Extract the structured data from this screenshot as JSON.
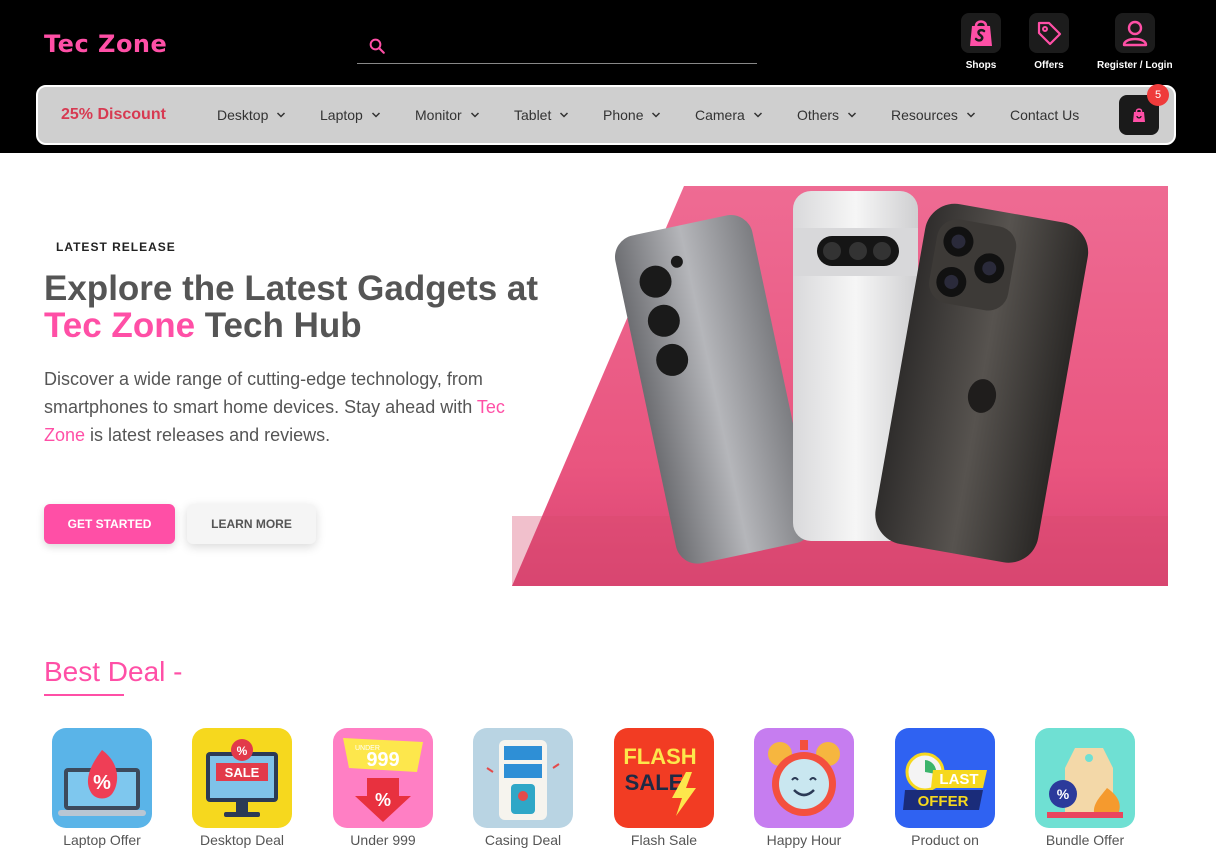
{
  "header": {
    "logo": "Tec Zone",
    "search_placeholder": "",
    "icons": [
      {
        "label": "Shops",
        "icon": "shopify-bag-icon"
      },
      {
        "label": "Offers",
        "icon": "tag-icon"
      },
      {
        "label": "Register / Login",
        "icon": "user-icon"
      }
    ]
  },
  "nav": {
    "discount": "25% Discount",
    "items": [
      "Desktop",
      "Laptop",
      "Monitor",
      "Tablet",
      "Phone",
      "Camera",
      "Others",
      "Resources",
      "Contact Us"
    ],
    "cart_count": "5"
  },
  "hero": {
    "eyebrow": "LATEST RELEASE",
    "title_line1": "Explore the Latest Gadgets at",
    "title_brand": "Tec Zone",
    "title_rest": " Tech Hub",
    "desc_part1": "Discover a wide range of cutting-edge technology, from smartphones to smart home devices. Stay ahead with ",
    "desc_brand": "Tec Zone",
    "desc_part2": " is latest releases and reviews.",
    "primary_cta": "GET STARTED",
    "secondary_cta": "LEARN MORE"
  },
  "best_deal": {
    "title": "Best Deal -",
    "items": [
      {
        "label": "Laptop Offer",
        "icon": "laptop-offer-icon"
      },
      {
        "label": "Desktop Deal",
        "icon": "desktop-sale-icon"
      },
      {
        "label": "Under 999",
        "icon": "under-999-icon"
      },
      {
        "label": "Casing Deal",
        "icon": "casing-icon"
      },
      {
        "label": "Flash Sale",
        "icon": "flash-sale-icon"
      },
      {
        "label": "Happy Hour",
        "icon": "alarm-clock-icon"
      },
      {
        "label": "Product on",
        "icon": "last-offer-icon"
      },
      {
        "label": "Bundle Offer",
        "icon": "bundle-tag-icon"
      }
    ],
    "tile_text": {
      "sale": "SALE",
      "under": "UNDER",
      "price": "999",
      "flash": "FLASH",
      "sale2": "SALE",
      "last": "LAST",
      "offer": "OFFER"
    }
  },
  "colors": {
    "brand_pink": "#ff4fa6",
    "header_bg": "#000000",
    "nav_bg": "#cfcfcf",
    "discount_red": "#d73a52"
  }
}
